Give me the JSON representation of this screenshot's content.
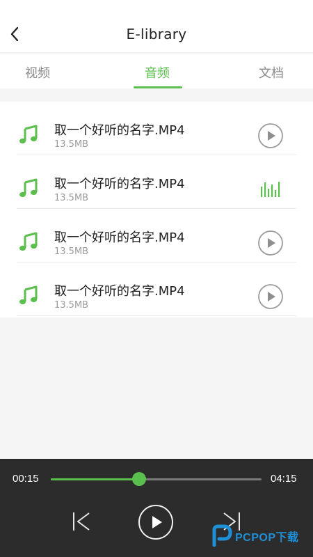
{
  "header": {
    "title": "E-library",
    "back_icon": "chevron-left-icon"
  },
  "tabs": [
    {
      "label": "视频",
      "active": false
    },
    {
      "label": "音频",
      "active": true
    },
    {
      "label": "文档",
      "active": false
    }
  ],
  "colors": {
    "accent": "#5bbf4e",
    "player_bg": "#2c2c2c",
    "text_primary": "#222222",
    "text_secondary": "#9b9b9b"
  },
  "tracks": [
    {
      "name": "取一个好听的名字.MP4",
      "size": "13.5MB",
      "state": "paused",
      "icon": "play-circle-icon"
    },
    {
      "name": "取一个好听的名字.MP4",
      "size": "13.5MB",
      "state": "playing",
      "icon": "equalizer-icon"
    },
    {
      "name": "取一个好听的名字.MP4",
      "size": "13.5MB",
      "state": "paused",
      "icon": "play-circle-icon"
    },
    {
      "name": "取一个好听的名字.MP4",
      "size": "13.5MB",
      "state": "paused",
      "icon": "play-circle-icon"
    }
  ],
  "player": {
    "current_time": "00:15",
    "total_time": "04:15",
    "progress": 0.42
  },
  "brand": {
    "text": "PCPOP下载"
  }
}
